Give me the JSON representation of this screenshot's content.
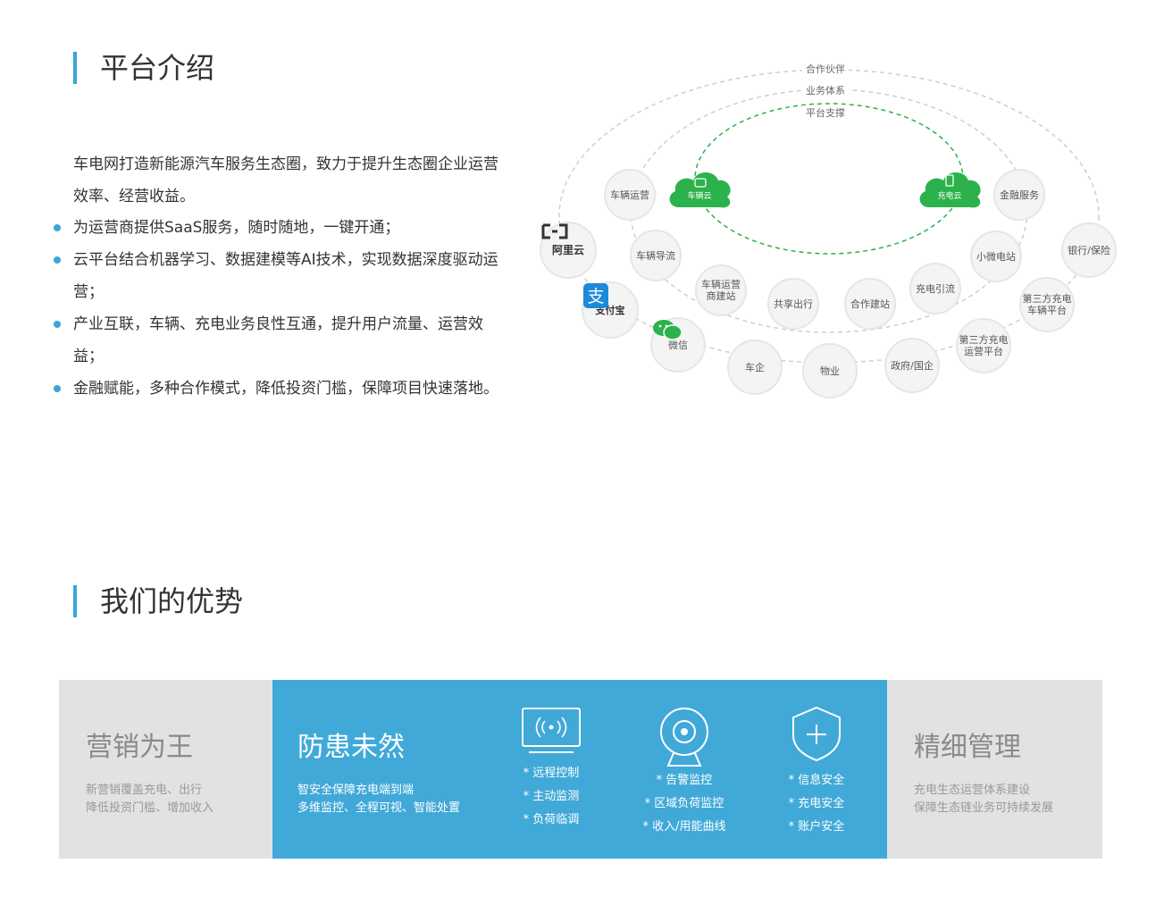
{
  "intro": {
    "title": "平台介绍",
    "paragraph": "车电网打造新能源汽车服务生态圈，致力于提升生态圈企业运营效率、经营收益。",
    "bullets": [
      "为运营商提供SaaS服务，随时随地，一键开通；",
      "云平台结合机器学习、数据建模等AI技术，实现数据深度驱动运营；",
      "产业互联，车辆、充电业务良性互通，提升用户流量、运营效益；",
      "金融赋能，多种合作模式，降低投资门槛，保障项目快速落地。"
    ]
  },
  "ecosystem": {
    "rings": [
      "合作伙伴",
      "业务体系",
      "平台支撑"
    ],
    "clouds": [
      "车辆云",
      "充电云"
    ],
    "nodes": {
      "vehicle_ops": "车辆运营",
      "vehicle_guide": "车辆导流",
      "vehicle_ops_station": "车辆运营商建站",
      "sharing": "共享出行",
      "coop_station": "合作建站",
      "charging_guide": "充电引流",
      "micro_station": "小微电站",
      "finance": "金融服务",
      "bank": "银行/保险",
      "third_vehicle": "第三方充电车辆平台",
      "third_ops": "第三方充电运营平台",
      "gov": "政府/国企",
      "property": "物业",
      "automaker": "车企",
      "wechat": "微信",
      "alipay": "支付宝",
      "aliyun": "阿里云"
    }
  },
  "advantages": {
    "title": "我们的优势",
    "cards": [
      {
        "title": "营销为王",
        "lines": [
          "新营销覆盖充电、出行",
          "降低投资门槛、增加收入"
        ]
      },
      {
        "title": "防患未然",
        "lines": [
          "智安全保障充电端到端",
          "多维监控、全程可视、智能处置"
        ],
        "features": [
          {
            "icon": "remote-monitor-icon",
            "items": [
              "* 远程控制",
              "* 主动监测",
              "* 负荷临调"
            ]
          },
          {
            "icon": "camera-icon",
            "items": [
              "* 告警监控",
              "* 区域负荷监控",
              "* 收入/用能曲线"
            ]
          },
          {
            "icon": "shield-icon",
            "items": [
              "* 信息安全",
              "* 充电安全",
              "* 账户安全"
            ]
          }
        ]
      },
      {
        "title": "精细管理",
        "lines": [
          "充电生态运营体系建设",
          "保障生态链业务可持续发展"
        ]
      }
    ]
  },
  "colors": {
    "accent": "#3aa5d6",
    "card_blue": "#41a9d8",
    "card_gray": "#e2e2e2",
    "cloud_green": "#2bb24c"
  }
}
